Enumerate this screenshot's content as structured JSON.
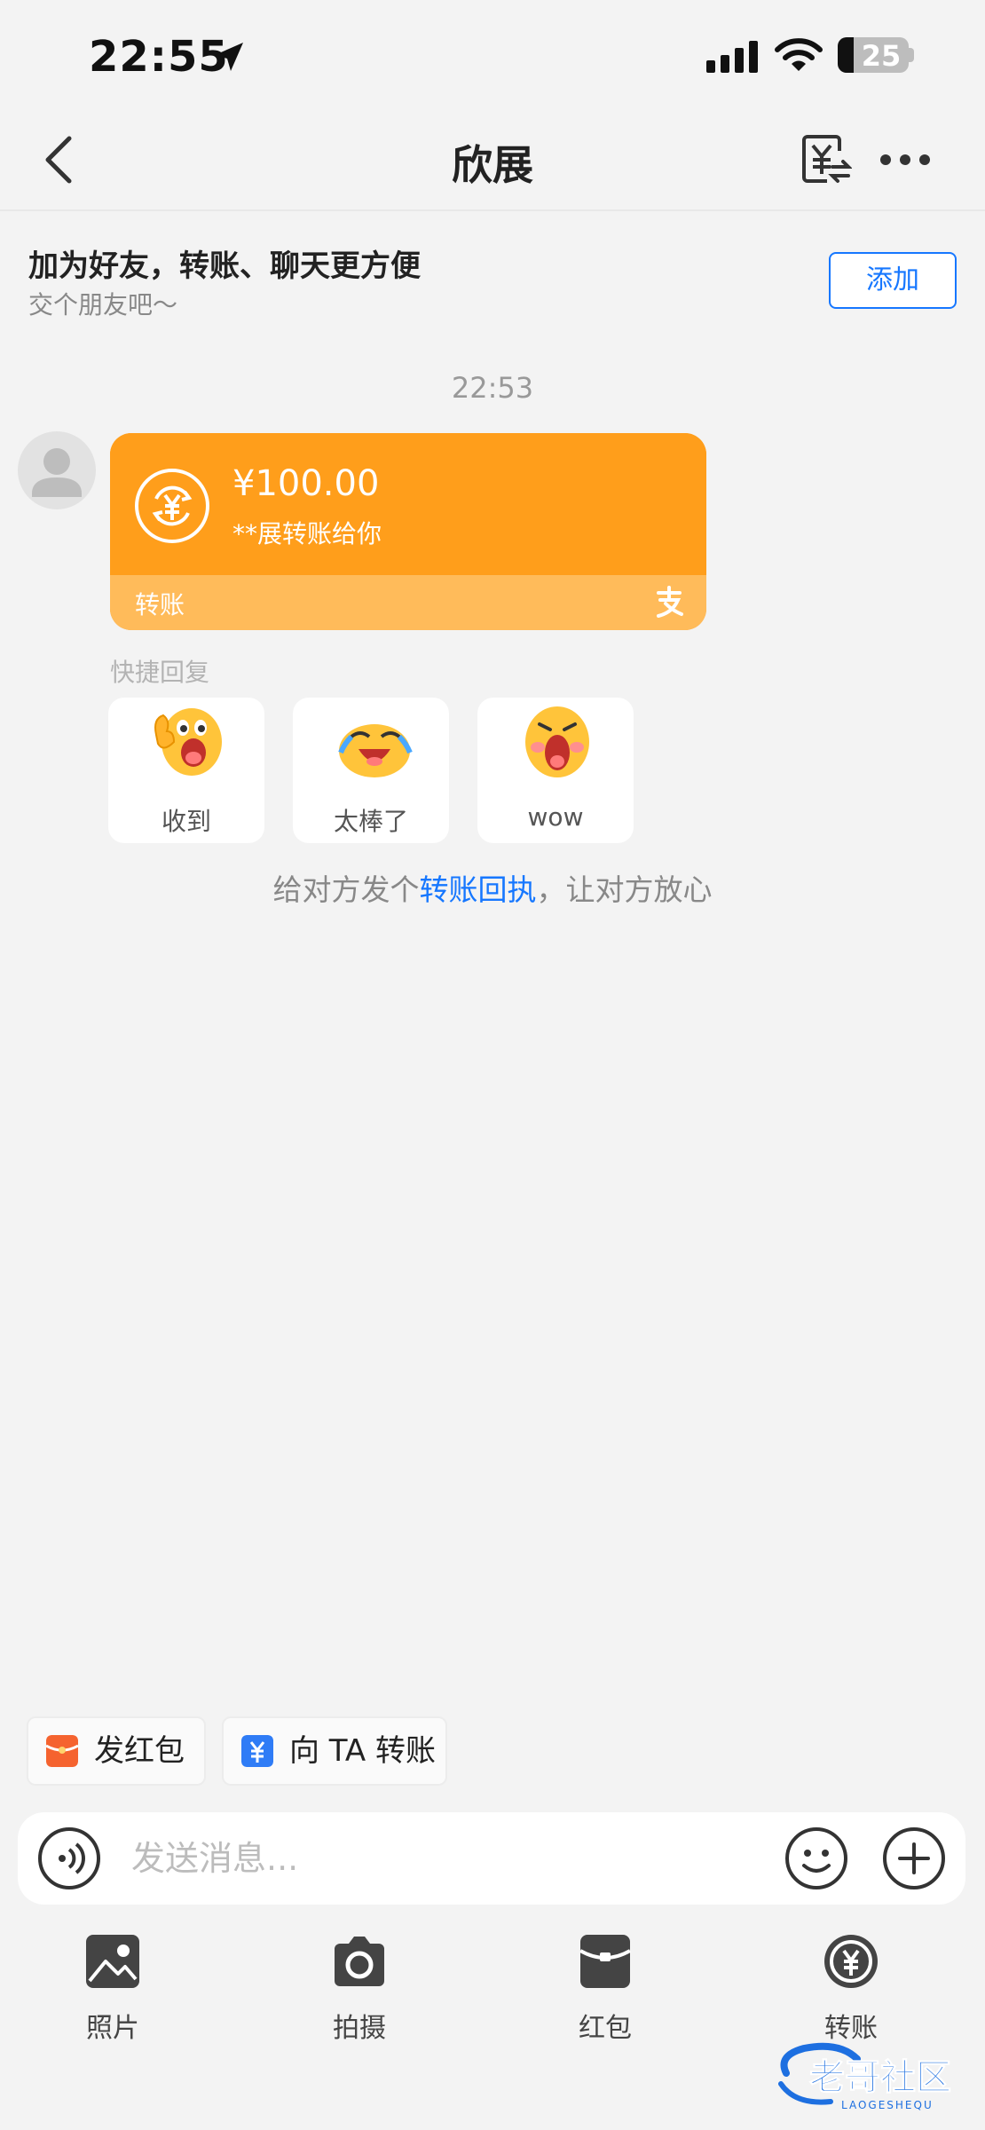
{
  "status_bar": {
    "time": "22:55",
    "battery": "25",
    "icons": [
      "location-arrow-icon",
      "signal-icon",
      "wifi-icon",
      "battery-icon"
    ]
  },
  "nav": {
    "title": "欣展",
    "icons": [
      "back-icon",
      "bill-icon",
      "more-icon"
    ]
  },
  "friend_bar": {
    "title": "加为好友，转账、聊天更方便",
    "subtitle": "交个朋友吧～",
    "add_label": "添加"
  },
  "chat": {
    "timestamp": "22:53",
    "transfer": {
      "amount": "¥100.00",
      "description": "**展转账给你",
      "label": "转账"
    },
    "quick_reply": {
      "title": "快捷回复",
      "options": [
        {
          "label": "收到",
          "icon": "ok-hand-emoji"
        },
        {
          "label": "太棒了",
          "icon": "laugh-cry-emoji"
        },
        {
          "label": "wow",
          "icon": "wow-emoji"
        }
      ]
    },
    "receipt": {
      "prefix": "给对方发个",
      "link": "转账回执",
      "suffix": "，让对方放心"
    }
  },
  "shortcuts": {
    "red_packet": "发红包",
    "transfer": "向 TA 转账"
  },
  "input": {
    "placeholder": "发送消息..."
  },
  "toolbar": [
    {
      "label": "照片",
      "icon": "photo-icon"
    },
    {
      "label": "拍摄",
      "icon": "camera-icon"
    },
    {
      "label": "红包",
      "icon": "red-packet-icon"
    },
    {
      "label": "转账",
      "icon": "transfer-icon"
    }
  ],
  "watermark": {
    "text": "老哥社区",
    "sub": "LAOGESHEQU"
  },
  "colors": {
    "accent_blue": "#1677ff",
    "transfer_orange": "#ff9e1b",
    "background": "#f3f3f3"
  }
}
